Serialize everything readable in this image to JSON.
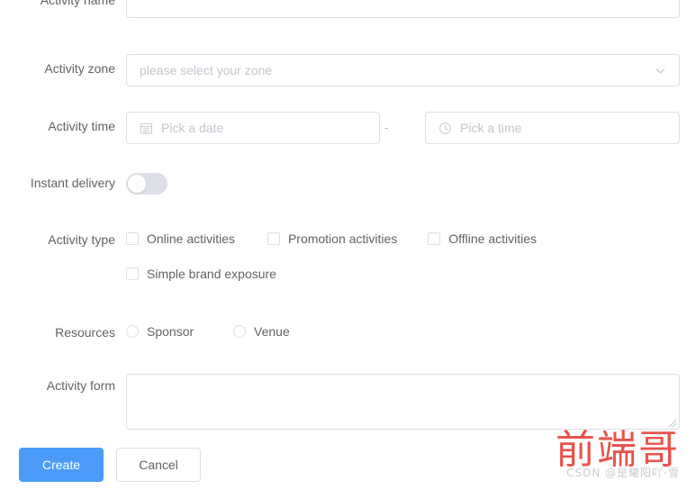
{
  "form": {
    "fields": {
      "activity_name": {
        "label": "Activity name",
        "value": "",
        "placeholder": ""
      },
      "activity_zone": {
        "label": "Activity zone",
        "value": "",
        "placeholder": "please select your zone",
        "chevron_icon": "chevron-down-icon"
      },
      "activity_time": {
        "label": "Activity time",
        "date_placeholder": "Pick a date",
        "date_icon": "calendar-icon",
        "separator": "-",
        "time_placeholder": "Pick a time",
        "time_icon": "clock-icon"
      },
      "instant_delivery": {
        "label": "Instant delivery",
        "checked": false
      },
      "activity_type": {
        "label": "Activity type",
        "options": [
          {
            "label": "Online activities",
            "checked": false
          },
          {
            "label": "Promotion activities",
            "checked": false
          },
          {
            "label": "Offline activities",
            "checked": false
          },
          {
            "label": "Simple brand exposure",
            "checked": false
          }
        ]
      },
      "resources": {
        "label": "Resources",
        "options": [
          {
            "label": "Sponsor",
            "checked": false
          },
          {
            "label": "Venue",
            "checked": false
          }
        ]
      },
      "activity_form": {
        "label": "Activity form",
        "value": ""
      }
    },
    "actions": {
      "submit_label": "Create",
      "cancel_label": "Cancel"
    }
  },
  "watermark": {
    "main": "前端哥",
    "sub": "CSDN @是曦阳吖·雪"
  },
  "colors": {
    "primary": "#4a9cf8",
    "border": "#dcdfe6",
    "label_text": "#606266",
    "placeholder_text": "#c2c6ce",
    "watermark_red": "#e8453c"
  }
}
